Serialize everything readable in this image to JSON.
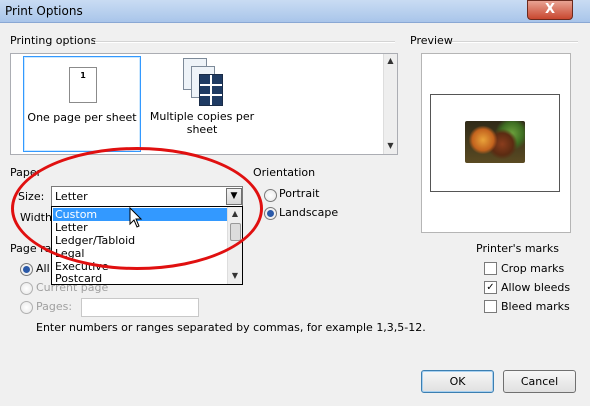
{
  "window": {
    "title": "Print Options",
    "close_glyph": "X"
  },
  "printing_options": {
    "label": "Printing options",
    "items": [
      {
        "label": "One page per sheet",
        "page_number": "1",
        "selected": true
      },
      {
        "label": "Multiple copies per sheet",
        "selected": false
      }
    ]
  },
  "preview": {
    "label": "Preview"
  },
  "paper": {
    "label": "Paper",
    "size_label": "Size:",
    "size_value": "Letter",
    "width_label": "Width:",
    "dropdown_options": [
      "Custom",
      "Letter",
      "Ledger/Tabloid",
      "Legal",
      "Executive",
      "Postcard"
    ],
    "highlighted_option": "Custom"
  },
  "orientation": {
    "label": "Orientation",
    "portrait": "Portrait",
    "landscape": "Landscape",
    "selected": "Landscape"
  },
  "page_range": {
    "label": "Page ra",
    "all": "All p",
    "current_page": "Current page",
    "pages": "Pages:",
    "pages_value": "",
    "hint": "Enter numbers or ranges separated by commas, for example 1,3,5-12."
  },
  "printers_marks": {
    "label": "Printer's marks",
    "crop_marks": {
      "label": "Crop marks",
      "checked": false
    },
    "allow_bleeds": {
      "label": "Allow bleeds",
      "checked": true
    },
    "bleed_marks": {
      "label": "Bleed marks",
      "checked": false
    }
  },
  "buttons": {
    "ok": "OK",
    "cancel": "Cancel"
  },
  "colors": {
    "annotation": "#e01010",
    "selection": "#3399ff"
  }
}
